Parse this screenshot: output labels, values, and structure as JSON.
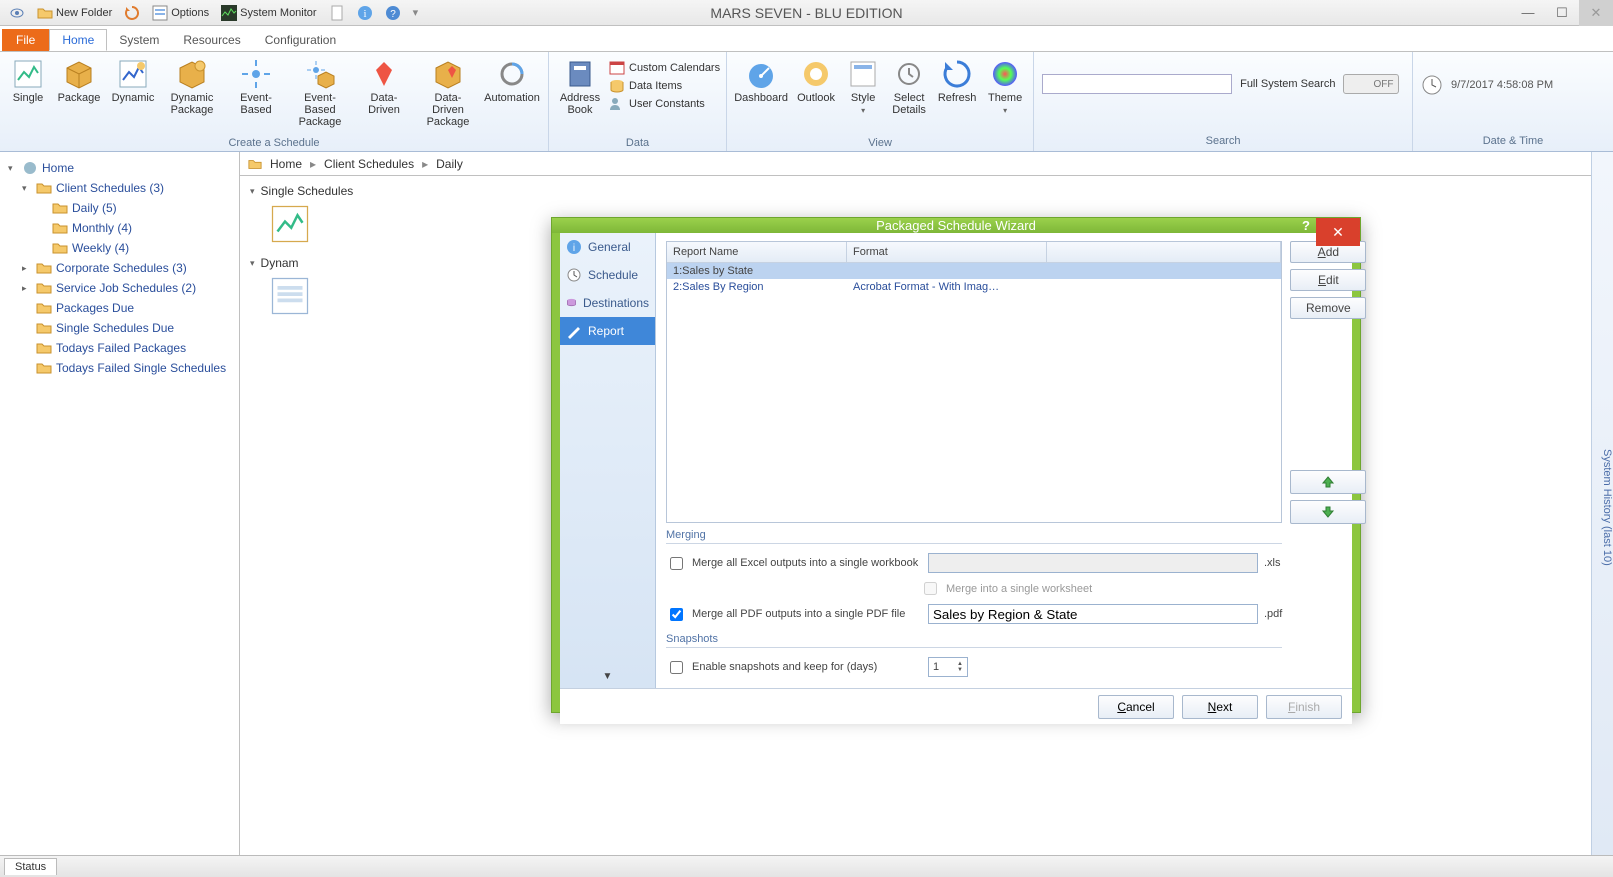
{
  "app": {
    "title": "MARS SEVEN - BLU EDITION"
  },
  "qat": {
    "new_folder": "New Folder",
    "options": "Options",
    "system_monitor": "System Monitor"
  },
  "tabs": {
    "file": "File",
    "home": "Home",
    "system": "System",
    "resources": "Resources",
    "configuration": "Configuration"
  },
  "ribbon": {
    "create": {
      "label": "Create a Schedule",
      "single": "Single",
      "package": "Package",
      "dynamic": "Dynamic",
      "dynamic_package": "Dynamic Package",
      "event_based": "Event-Based",
      "event_based_package": "Event-Based Package",
      "data_driven": "Data-Driven",
      "data_driven_package": "Data-Driven Package",
      "automation": "Automation"
    },
    "data": {
      "label": "Data",
      "address_book": "Address Book",
      "custom_calendars": "Custom Calendars",
      "data_items": "Data Items",
      "user_constants": "User Constants"
    },
    "view": {
      "label": "View",
      "dashboard": "Dashboard",
      "outlook": "Outlook",
      "style": "Style",
      "select_details": "Select Details",
      "refresh": "Refresh",
      "theme": "Theme"
    },
    "search": {
      "label": "Search",
      "full_label": "Full System Search",
      "toggle": "OFF"
    },
    "datetime": {
      "label": "Date & Time",
      "value": "9/7/2017 4:58:08 PM"
    }
  },
  "nav": {
    "home": "Home",
    "client_schedules": "Client Schedules (3)",
    "daily": "Daily (5)",
    "monthly": "Monthly (4)",
    "weekly": "Weekly (4)",
    "corporate": "Corporate Schedules (3)",
    "service": "Service Job Schedules (2)",
    "packages_due": "Packages Due",
    "single_due": "Single Schedules Due",
    "failed_packages": "Todays Failed Packages",
    "failed_singles": "Todays Failed Single Schedules"
  },
  "breadcrumb": {
    "a": "Home",
    "b": "Client Schedules",
    "c": "Daily"
  },
  "content": {
    "group1": "Single Schedules",
    "group2": "Dynam"
  },
  "side_panel": "System History (last 10)",
  "status": "Status",
  "wizard": {
    "title": "Packaged Schedule Wizard",
    "nav": {
      "general": "General",
      "schedule": "Schedule",
      "destinations": "Destinations",
      "report": "Report"
    },
    "table": {
      "col1": "Report Name",
      "col2": "Format",
      "r1_name": "1:Sales by State",
      "r1_fmt": "",
      "r2_name": "2:Sales By Region",
      "r2_fmt": "Acrobat Format - With Imag…"
    },
    "buttons": {
      "add": "Add",
      "edit": "Edit",
      "remove": "Remove"
    },
    "merging": {
      "label": "Merging",
      "excel": "Merge all Excel outputs into a single workbook",
      "worksheet": "Merge into a single worksheet",
      "pdf": "Merge all PDF outputs into a single PDF file",
      "pdf_value": "Sales by Region & State",
      "xls_ext": ".xls",
      "pdf_ext": ".pdf"
    },
    "snapshots": {
      "label": "Snapshots",
      "enable": "Enable snapshots and keep for (days)",
      "days": "1"
    },
    "footer": {
      "cancel": "Cancel",
      "next": "Next",
      "finish": "Finish"
    }
  }
}
